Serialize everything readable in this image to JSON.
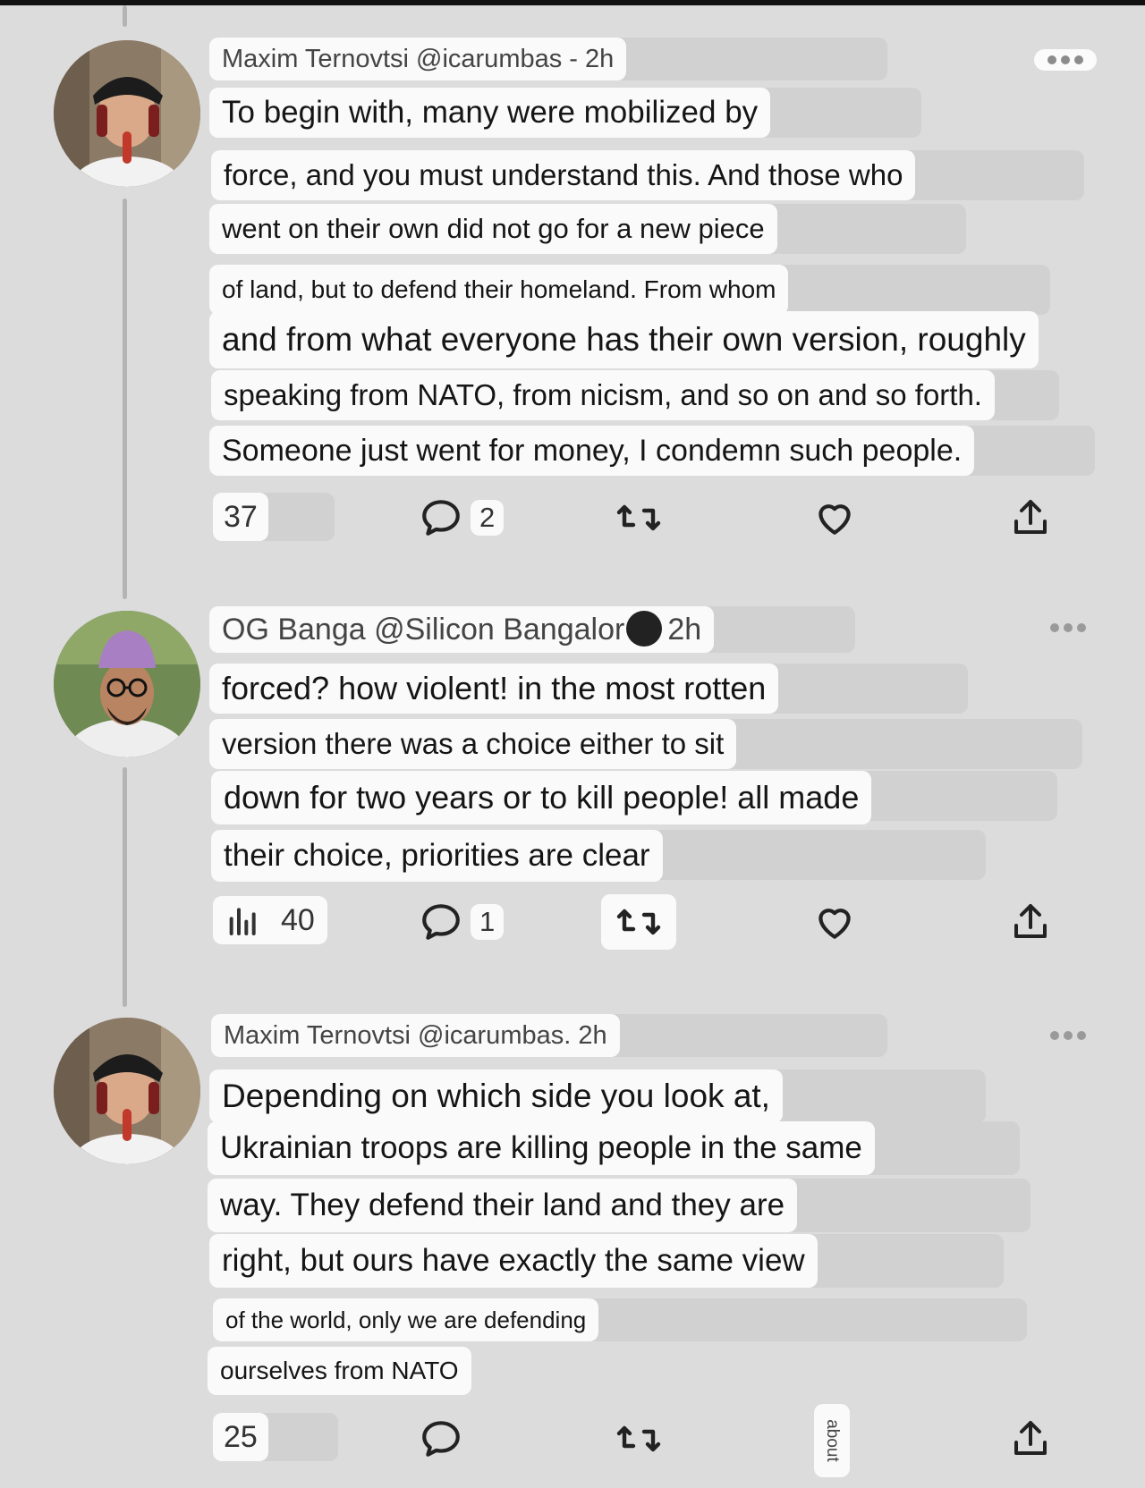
{
  "posts": [
    {
      "meta": "Maxim Ternovtsi @icarumbas - 2h",
      "lines": [
        "To begin with, many were mobilized by",
        "force, and you must understand this. And those who",
        "went on their own did not go for a new piece",
        "of land, but to defend their homeland. From whom",
        "and from what everyone has their own version, roughly",
        "speaking from NATO, from nicism, and so on and so forth.",
        "Someone just went for money, I condemn such people."
      ],
      "views": "37",
      "replies": "2"
    },
    {
      "meta_name": "OG Banga @Silicon Bangalor",
      "meta_time": "2h",
      "lines": [
        "forced? how violent! in the most rotten",
        "version there was a choice either to sit",
        "down for two years or to kill people! all made",
        "their choice, priorities are clear"
      ],
      "views": "40",
      "replies": "1"
    },
    {
      "meta": "Maxim Ternovtsi @icarumbas. 2h",
      "lines": [
        "Depending on which side you look at,",
        "Ukrainian troops are killing people in the same",
        "way. They defend their land and they are",
        "right, but ours have exactly the same view",
        "of the world, only we are defending",
        "ourselves from NATO"
      ],
      "views": "25",
      "vertical_label": "about"
    }
  ],
  "icons": [
    "more-icon",
    "reply-icon",
    "repost-icon",
    "like-icon",
    "share-icon",
    "views-icon"
  ],
  "colors": {
    "background": "#dcdcdc",
    "bubble": "#fafafa",
    "thread_line": "#b4b4b4"
  }
}
